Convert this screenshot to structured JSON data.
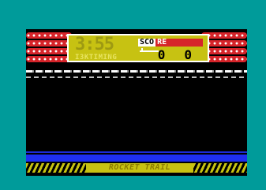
{
  "hud": {
    "timer": "3:55",
    "score_label_left": "SCO",
    "score_label_right": "RE",
    "event": "I3KTIMING",
    "score_player1": "0",
    "score_player2": "0"
  },
  "banner": {
    "text": "ROCKET TRAIL"
  },
  "colors": {
    "border": "#009b9a",
    "crowd": "#d6242a",
    "scoreboard": "#c7c212",
    "water": "#1f2ff0"
  }
}
